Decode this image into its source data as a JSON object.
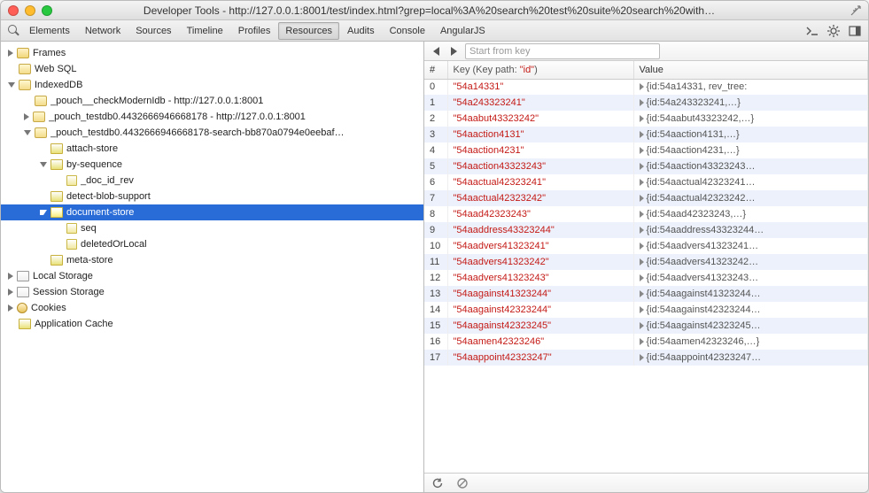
{
  "window": {
    "title": "Developer Tools - http://127.0.0.1:8001/test/index.html?grep=local%3A%20search%20test%20suite%20search%20with…"
  },
  "tabs": {
    "items": [
      "Elements",
      "Network",
      "Sources",
      "Timeline",
      "Profiles",
      "Resources",
      "Audits",
      "Console",
      "AngularJS"
    ],
    "active": "Resources"
  },
  "tree": [
    {
      "depth": 0,
      "tri": "right",
      "icon": "folder",
      "label": "Frames"
    },
    {
      "depth": 0,
      "tri": "none",
      "icon": "db",
      "label": "Web SQL"
    },
    {
      "depth": 0,
      "tri": "down",
      "icon": "db",
      "label": "IndexedDB"
    },
    {
      "depth": 1,
      "tri": "none",
      "icon": "db",
      "label": "_pouch__checkModernIdb - http://127.0.0.1:8001"
    },
    {
      "depth": 1,
      "tri": "right",
      "icon": "db",
      "label": "_pouch_testdb0.4432666946668178 - http://127.0.0.1:8001"
    },
    {
      "depth": 1,
      "tri": "down",
      "icon": "db",
      "label": "_pouch_testdb0.4432666946668178-search-bb870a0794e0eebaf…"
    },
    {
      "depth": 2,
      "tri": "none",
      "icon": "table",
      "label": "attach-store"
    },
    {
      "depth": 2,
      "tri": "down",
      "icon": "table",
      "label": "by-sequence"
    },
    {
      "depth": 3,
      "tri": "none",
      "icon": "col",
      "label": "_doc_id_rev"
    },
    {
      "depth": 2,
      "tri": "none",
      "icon": "table",
      "label": "detect-blob-support"
    },
    {
      "depth": 2,
      "tri": "down",
      "icon": "table",
      "label": "document-store",
      "selected": true
    },
    {
      "depth": 3,
      "tri": "none",
      "icon": "col",
      "label": "seq"
    },
    {
      "depth": 3,
      "tri": "none",
      "icon": "col",
      "label": "deletedOrLocal"
    },
    {
      "depth": 2,
      "tri": "none",
      "icon": "table",
      "label": "meta-store"
    },
    {
      "depth": 0,
      "tri": "right",
      "icon": "grid",
      "label": "Local Storage"
    },
    {
      "depth": 0,
      "tri": "right",
      "icon": "grid",
      "label": "Session Storage"
    },
    {
      "depth": 0,
      "tri": "right",
      "icon": "cookie",
      "label": "Cookies"
    },
    {
      "depth": 0,
      "tri": "none",
      "icon": "table",
      "label": "Application Cache"
    }
  ],
  "right": {
    "search_placeholder": "Start from key",
    "columns": {
      "idx": "#",
      "key_prefix": "Key (Key path: ",
      "key_id": "\"id\"",
      "key_suffix": ")",
      "value": "Value"
    },
    "rows": [
      {
        "i": 0,
        "key": "54a14331",
        "val": "{id:54a14331, rev_tree:"
      },
      {
        "i": 1,
        "key": "54a243323241",
        "val": "{id:54a243323241,…}"
      },
      {
        "i": 2,
        "key": "54aabut43323242",
        "val": "{id:54aabut43323242,…}"
      },
      {
        "i": 3,
        "key": "54aaction4131",
        "val": "{id:54aaction4131,…}"
      },
      {
        "i": 4,
        "key": "54aaction4231",
        "val": "{id:54aaction4231,…}"
      },
      {
        "i": 5,
        "key": "54aaction43323243",
        "val": "{id:54aaction43323243…"
      },
      {
        "i": 6,
        "key": "54aactual42323241",
        "val": "{id:54aactual42323241…"
      },
      {
        "i": 7,
        "key": "54aactual42323242",
        "val": "{id:54aactual42323242…"
      },
      {
        "i": 8,
        "key": "54aad42323243",
        "val": "{id:54aad42323243,…}"
      },
      {
        "i": 9,
        "key": "54aaddress43323244",
        "val": "{id:54aaddress43323244…"
      },
      {
        "i": 10,
        "key": "54aadvers41323241",
        "val": "{id:54aadvers41323241…"
      },
      {
        "i": 11,
        "key": "54aadvers41323242",
        "val": "{id:54aadvers41323242…"
      },
      {
        "i": 12,
        "key": "54aadvers41323243",
        "val": "{id:54aadvers41323243…"
      },
      {
        "i": 13,
        "key": "54aagainst41323244",
        "val": "{id:54aagainst41323244…"
      },
      {
        "i": 14,
        "key": "54aagainst42323244",
        "val": "{id:54aagainst42323244…"
      },
      {
        "i": 15,
        "key": "54aagainst42323245",
        "val": "{id:54aagainst42323245…"
      },
      {
        "i": 16,
        "key": "54aamen42323246",
        "val": "{id:54aamen42323246,…}"
      },
      {
        "i": 17,
        "key": "54aappoint42323247",
        "val": "{id:54aappoint42323247…"
      }
    ]
  }
}
